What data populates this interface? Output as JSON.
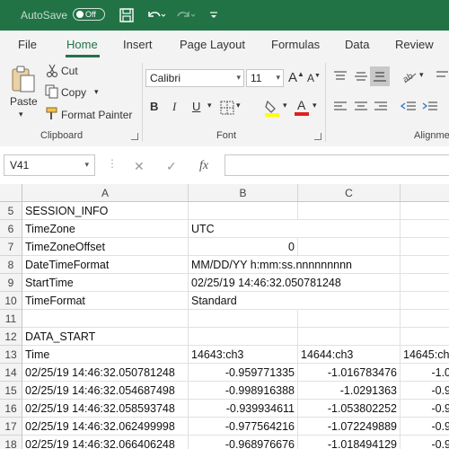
{
  "titlebar": {
    "autosave_label": "AutoSave",
    "toggle_state": "Off"
  },
  "tabs": [
    "File",
    "Home",
    "Insert",
    "Page Layout",
    "Formulas",
    "Data",
    "Review"
  ],
  "ribbon": {
    "clipboard": {
      "paste": "Paste",
      "cut": "Cut",
      "copy": "Copy",
      "format_painter": "Format Painter",
      "label": "Clipboard"
    },
    "font": {
      "name": "Calibri",
      "size": "11",
      "label": "Font"
    },
    "alignment": {
      "label": "Alignme"
    }
  },
  "formula_bar": {
    "name_box": "V41",
    "fx": "fx",
    "value": ""
  },
  "columns": [
    "A",
    "B",
    "C"
  ],
  "rows": [
    {
      "num": "5",
      "a": "SESSION_INFO",
      "b": "",
      "c": "",
      "d": ""
    },
    {
      "num": "6",
      "a": "TimeZone",
      "b": "UTC",
      "c": "",
      "d": ""
    },
    {
      "num": "7",
      "a": "TimeZoneOffset",
      "b": "0",
      "c": "",
      "d": ""
    },
    {
      "num": "8",
      "a": "DateTimeFormat",
      "b": "MM/DD/YY h:mm:ss.nnnnnnnnn",
      "c": "",
      "d": ""
    },
    {
      "num": "9",
      "a": "StartTime",
      "b": "02/25/19 14:46:32.050781248",
      "c": "",
      "d": ""
    },
    {
      "num": "10",
      "a": "TimeFormat",
      "b": "Standard",
      "c": "",
      "d": ""
    },
    {
      "num": "11",
      "a": "",
      "b": "",
      "c": "",
      "d": ""
    },
    {
      "num": "12",
      "a": "DATA_START",
      "b": "",
      "c": "",
      "d": ""
    },
    {
      "num": "13",
      "a": "Time",
      "b": "14643:ch3",
      "c": "14644:ch3",
      "d": "14645:ch"
    },
    {
      "num": "14",
      "a": "02/25/19 14:46:32.050781248",
      "b": "-0.959771335",
      "c": "-1.016783476",
      "d": "-1.0"
    },
    {
      "num": "15",
      "a": "02/25/19 14:46:32.054687498",
      "b": "-0.998916388",
      "c": "-1.0291363",
      "d": "-0.9"
    },
    {
      "num": "16",
      "a": "02/25/19 14:46:32.058593748",
      "b": "-0.939934611",
      "c": "-1.053802252",
      "d": "-0.9"
    },
    {
      "num": "17",
      "a": "02/25/19 14:46:32.062499998",
      "b": "-0.977564216",
      "c": "-1.072249889",
      "d": "-0.9"
    },
    {
      "num": "18",
      "a": "02/25/19 14:46:32.066406248",
      "b": "-0.968976676",
      "c": "-1.018494129",
      "d": "-0.9"
    }
  ]
}
